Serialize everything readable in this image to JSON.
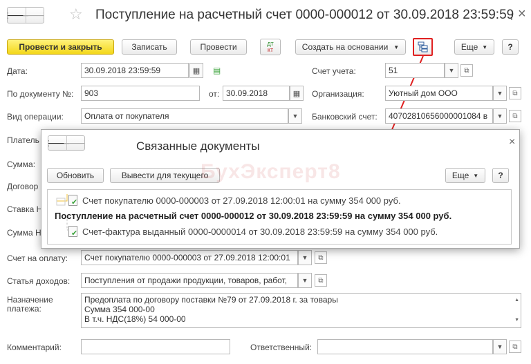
{
  "window": {
    "title": "Поступление на расчетный счет 0000-000012 от 30.09.2018 23:59:59",
    "more_glyph": "⋮",
    "close_glyph": "×"
  },
  "toolbar": {
    "post_close": "Провести и закрыть",
    "save": "Записать",
    "post": "Провести",
    "dt_kt_top": "дт",
    "dt_kt_bottom": "кт",
    "create_based": "Создать на основании",
    "more": "Еще",
    "help": "?"
  },
  "form": {
    "date_label": "Дата:",
    "date_value": "30.09.2018 23:59:59",
    "account_label": "Счет учета:",
    "account_value": "51",
    "doc_no_label": "По документу №:",
    "doc_no_value": "903",
    "from_label": "от:",
    "from_value": "30.09.2018",
    "org_label": "Организация:",
    "org_value": "Уютный дом ООО",
    "op_type_label": "Вид операции:",
    "op_type_value": "Оплата от покупателя",
    "bank_label": "Банковский счет:",
    "bank_value": "40702810656000001084 в",
    "payer_label": "Платель",
    "sum_label": "Сумма:",
    "contract_label": "Договор",
    "vat_rate_label": "Ставка Н",
    "vat_sum_label": "Сумма Н",
    "invoice_label": "Счет на оплату:",
    "invoice_value": "Счет покупателю 0000-000003 от 27.09.2018 12:00:01",
    "income_label": "Статья доходов:",
    "income_value": "Поступления от продажи продукции, товаров, работ,",
    "purpose_label_1": "Назначение",
    "purpose_label_2": "платежа:",
    "purpose_line_1": "Предоплата по договору поставки №79 от 27.09.2018 г. за товары",
    "purpose_line_2": "Сумма 354 000-00",
    "purpose_line_3": "В т.ч. НДС(18%) 54 000-00",
    "comment_label": "Комментарий:",
    "comment_value": "",
    "responsible_label": "Ответственный:",
    "responsible_value": ""
  },
  "modal": {
    "title": "Связанные документы",
    "refresh": "Обновить",
    "show_current": "Вывести для текущего",
    "more": "Еще",
    "help": "?",
    "close_glyph": "×",
    "rows": [
      "Счет покупателю 0000-000003 от 27.09.2018 12:00:01 на сумму 354 000 руб.",
      "Поступление на расчетный счет 0000-000012 от 30.09.2018 23:59:59 на сумму 354 000 руб.",
      "Счет-фактура выданный 0000-0000014 от 30.09.2018 23:59:59 на сумму 354 000 руб."
    ]
  },
  "watermark": "БухЭксперт8",
  "colors": {
    "primary_button": "#f3d71a",
    "highlight_red": "#e02020",
    "check_green": "#3aa33a"
  }
}
